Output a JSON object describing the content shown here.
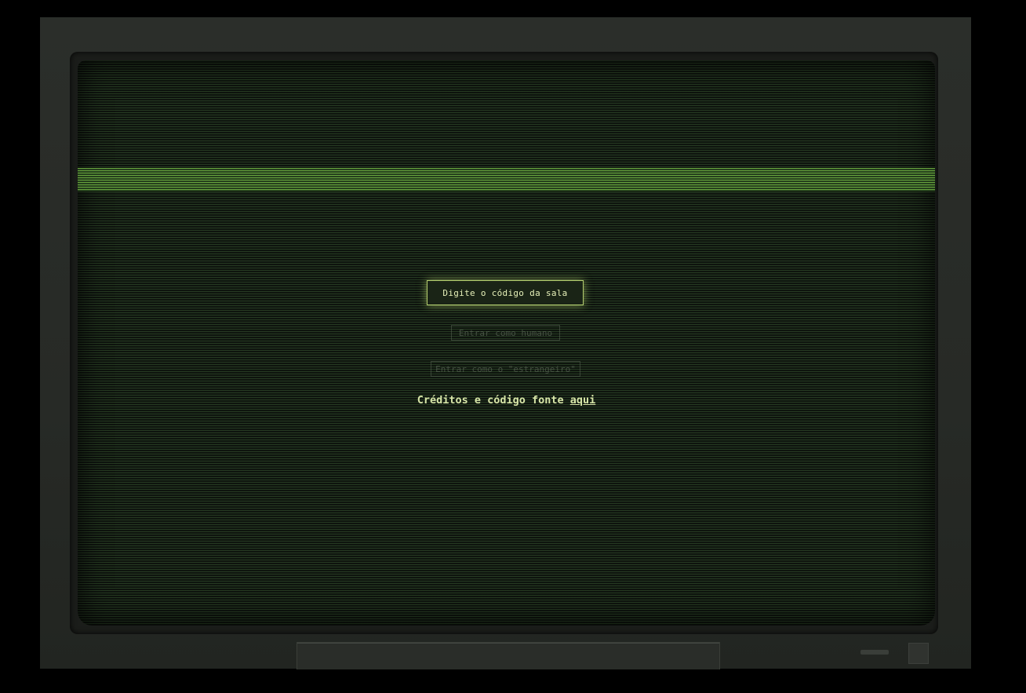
{
  "room_code_button": "Digite o código da sala",
  "enter_as_human_button": "Entrar como humano",
  "enter_as_stranger_button": "Entrar como o \"estrangeiro\"",
  "credits": {
    "text": "Créditos e código fonte ",
    "link_label": "aqui"
  }
}
